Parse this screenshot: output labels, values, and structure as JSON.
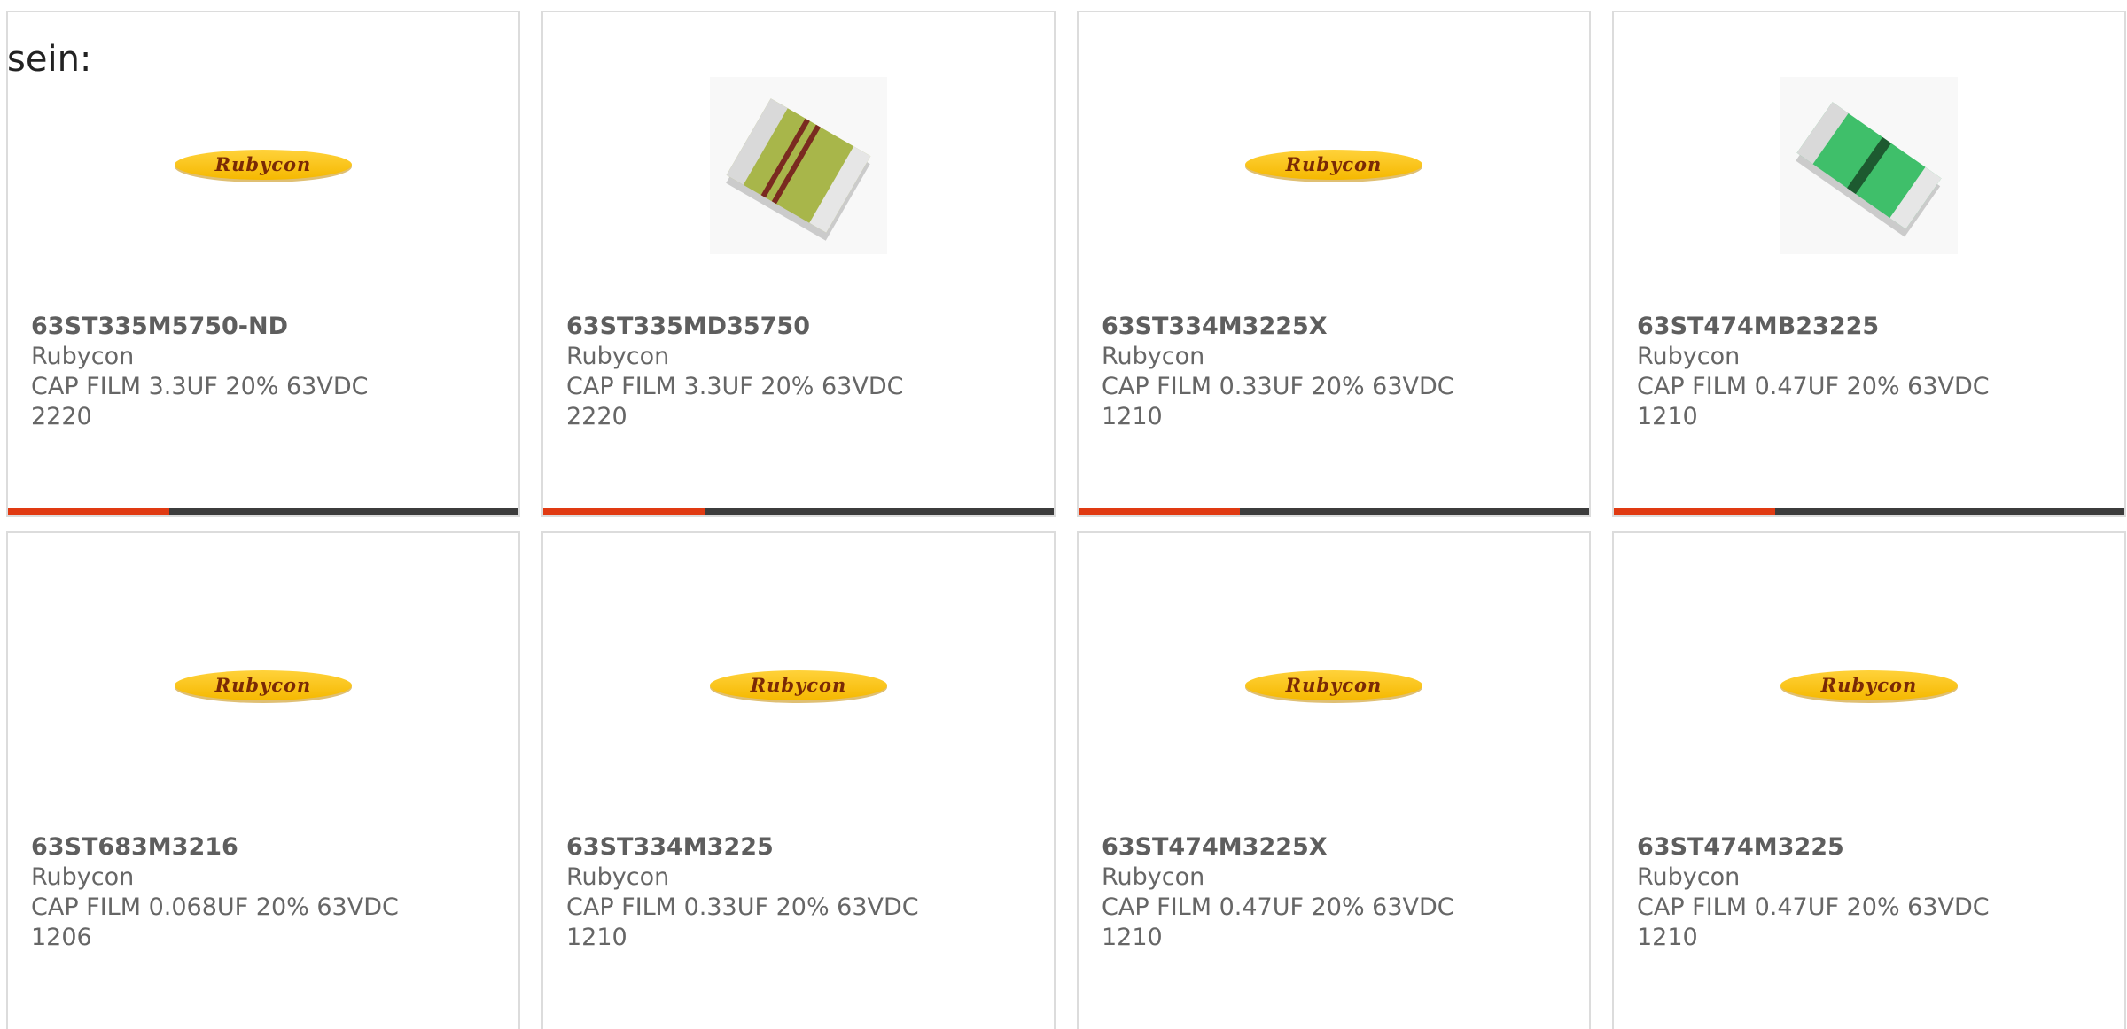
{
  "intro_text": "sein:",
  "colors": {
    "accent": "#e03a12",
    "bar": "#3c3c3c",
    "border": "#dcdcdc",
    "text": "#666666",
    "logo_yellow": "#f5b800",
    "logo_text": "#7a2a05"
  },
  "cards": [
    {
      "part_number": "63ST335M5750-ND",
      "manufacturer": "Rubycon",
      "description": "CAP FILM 3.3UF 20% 63VDC",
      "package": "2220",
      "image": "rubycon-logo",
      "logo_text": "Rubycon",
      "show_bar": true
    },
    {
      "part_number": "63ST335MD35750",
      "manufacturer": "Rubycon",
      "description": "CAP FILM 3.3UF 20% 63VDC",
      "package": "2220",
      "image": "film-capacitor-yellow-chip",
      "show_bar": true
    },
    {
      "part_number": "63ST334M3225X",
      "manufacturer": "Rubycon",
      "description": "CAP FILM 0.33UF 20% 63VDC",
      "package": "1210",
      "image": "rubycon-logo",
      "logo_text": "Rubycon",
      "show_bar": true
    },
    {
      "part_number": "63ST474MB23225",
      "manufacturer": "Rubycon",
      "description": "CAP FILM 0.47UF 20% 63VDC",
      "package": "1210",
      "image": "film-capacitor-green-chip",
      "show_bar": true
    },
    {
      "part_number": "63ST683M3216",
      "manufacturer": "Rubycon",
      "description": "CAP FILM 0.068UF 20% 63VDC",
      "package": "1206",
      "image": "rubycon-logo",
      "logo_text": "Rubycon",
      "show_bar": false
    },
    {
      "part_number": "63ST334M3225",
      "manufacturer": "Rubycon",
      "description": "CAP FILM 0.33UF 20% 63VDC",
      "package": "1210",
      "image": "rubycon-logo",
      "logo_text": "Rubycon",
      "show_bar": false
    },
    {
      "part_number": "63ST474M3225X",
      "manufacturer": "Rubycon",
      "description": "CAP FILM 0.47UF 20% 63VDC",
      "package": "1210",
      "image": "rubycon-logo",
      "logo_text": "Rubycon",
      "show_bar": false
    },
    {
      "part_number": "63ST474M3225",
      "manufacturer": "Rubycon",
      "description": "CAP FILM 0.47UF 20% 63VDC",
      "package": "1210",
      "image": "rubycon-logo",
      "logo_text": "Rubycon",
      "show_bar": false
    }
  ]
}
